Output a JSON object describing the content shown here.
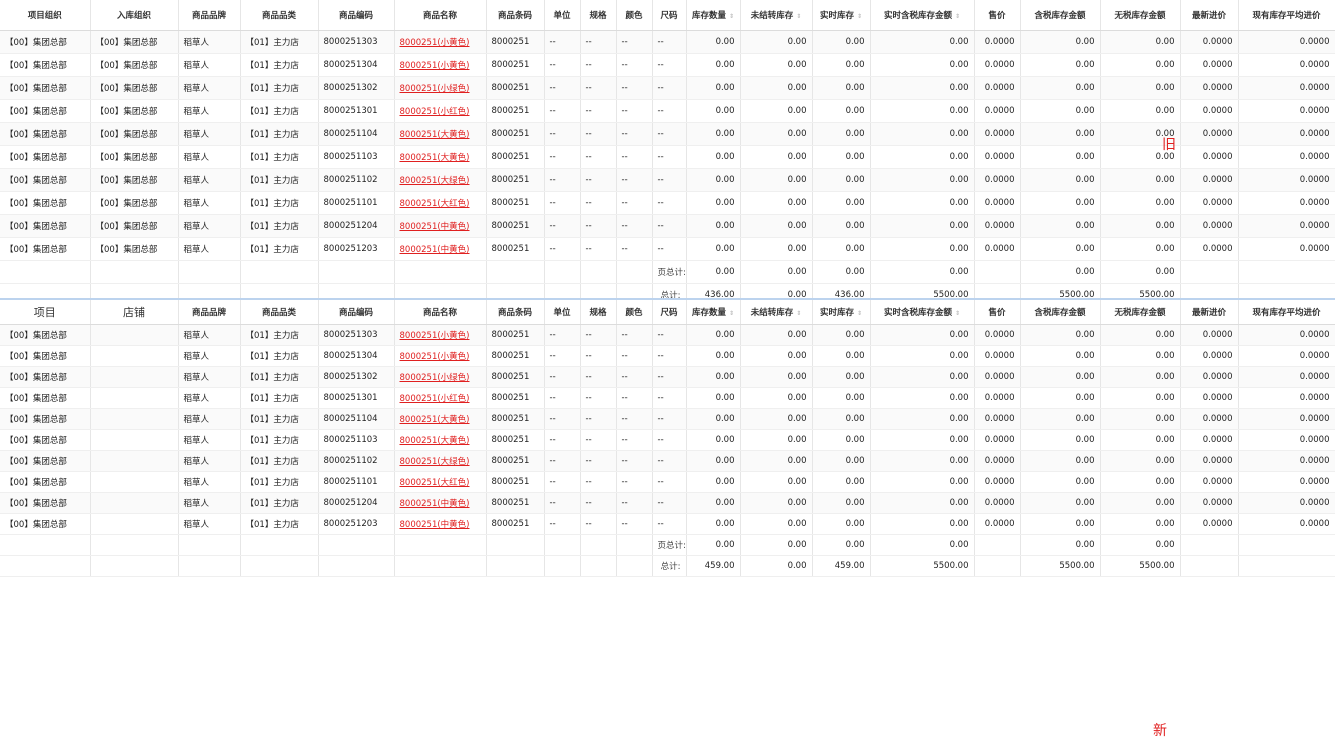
{
  "old_table": {
    "columns": [
      {
        "label": "项目组织",
        "sortable": false
      },
      {
        "label": "入库组织",
        "sortable": false
      },
      {
        "label": "商品品牌",
        "sortable": false
      },
      {
        "label": "商品品类",
        "sortable": false
      },
      {
        "label": "商品编码",
        "sortable": false
      },
      {
        "label": "商品名称",
        "sortable": false
      },
      {
        "label": "商品条码",
        "sortable": false
      },
      {
        "label": "单位",
        "sortable": false
      },
      {
        "label": "规格",
        "sortable": false
      },
      {
        "label": "颜色",
        "sortable": false
      },
      {
        "label": "尺码",
        "sortable": false
      },
      {
        "label": "库存数量",
        "sortable": true
      },
      {
        "label": "未结转库存",
        "sortable": true
      },
      {
        "label": "实时库存",
        "sortable": true
      },
      {
        "label": "实时含税库存金额",
        "sortable": true
      },
      {
        "label": "售价",
        "sortable": false
      },
      {
        "label": "含税库存金额",
        "sortable": false
      },
      {
        "label": "无税库存金额",
        "sortable": false
      },
      {
        "label": "最新进价",
        "sortable": false
      },
      {
        "label": "现有库存平均进价",
        "sortable": false
      }
    ],
    "rows": [
      [
        "【00】集团总部",
        "【00】集团总部",
        "稻草人",
        "【01】主力店",
        "8000251303",
        "8000251(小黄色)",
        "8000251",
        "--",
        "--",
        "--",
        "--",
        "0.00",
        "0.00",
        "0.00",
        "0.00",
        "0.0000",
        "0.00",
        "0.00",
        "0.0000",
        "0.0000"
      ],
      [
        "【00】集团总部",
        "【00】集团总部",
        "稻草人",
        "【01】主力店",
        "8000251304",
        "8000251(小黄色)",
        "8000251",
        "--",
        "--",
        "--",
        "--",
        "0.00",
        "0.00",
        "0.00",
        "0.00",
        "0.0000",
        "0.00",
        "0.00",
        "0.0000",
        "0.0000"
      ],
      [
        "【00】集团总部",
        "【00】集团总部",
        "稻草人",
        "【01】主力店",
        "8000251302",
        "8000251(小绿色)",
        "8000251",
        "--",
        "--",
        "--",
        "--",
        "0.00",
        "0.00",
        "0.00",
        "0.00",
        "0.0000",
        "0.00",
        "0.00",
        "0.0000",
        "0.0000"
      ],
      [
        "【00】集团总部",
        "【00】集团总部",
        "稻草人",
        "【01】主力店",
        "8000251301",
        "8000251(小红色)",
        "8000251",
        "--",
        "--",
        "--",
        "--",
        "0.00",
        "0.00",
        "0.00",
        "0.00",
        "0.0000",
        "0.00",
        "0.00",
        "0.0000",
        "0.0000"
      ],
      [
        "【00】集团总部",
        "【00】集团总部",
        "稻草人",
        "【01】主力店",
        "8000251104",
        "8000251(大黄色)",
        "8000251",
        "--",
        "--",
        "--",
        "--",
        "0.00",
        "0.00",
        "0.00",
        "0.00",
        "0.0000",
        "0.00",
        "0.00",
        "0.0000",
        "0.0000"
      ],
      [
        "【00】集团总部",
        "【00】集团总部",
        "稻草人",
        "【01】主力店",
        "8000251103",
        "8000251(大黄色)",
        "8000251",
        "--",
        "--",
        "--",
        "--",
        "0.00",
        "0.00",
        "0.00",
        "0.00",
        "0.0000",
        "0.00",
        "0.00",
        "0.0000",
        "0.0000"
      ],
      [
        "【00】集团总部",
        "【00】集团总部",
        "稻草人",
        "【01】主力店",
        "8000251102",
        "8000251(大绿色)",
        "8000251",
        "--",
        "--",
        "--",
        "--",
        "0.00",
        "0.00",
        "0.00",
        "0.00",
        "0.0000",
        "0.00",
        "0.00",
        "0.0000",
        "0.0000"
      ],
      [
        "【00】集团总部",
        "【00】集团总部",
        "稻草人",
        "【01】主力店",
        "8000251101",
        "8000251(大红色)",
        "8000251",
        "--",
        "--",
        "--",
        "--",
        "0.00",
        "0.00",
        "0.00",
        "0.00",
        "0.0000",
        "0.00",
        "0.00",
        "0.0000",
        "0.0000"
      ],
      [
        "【00】集团总部",
        "【00】集团总部",
        "稻草人",
        "【01】主力店",
        "8000251204",
        "8000251(中黄色)",
        "8000251",
        "--",
        "--",
        "--",
        "--",
        "0.00",
        "0.00",
        "0.00",
        "0.00",
        "0.0000",
        "0.00",
        "0.00",
        "0.0000",
        "0.0000"
      ],
      [
        "【00】集团总部",
        "【00】集团总部",
        "稻草人",
        "【01】主力店",
        "8000251203",
        "8000251(中黄色)",
        "8000251",
        "--",
        "--",
        "--",
        "--",
        "0.00",
        "0.00",
        "0.00",
        "0.00",
        "0.0000",
        "0.00",
        "0.00",
        "0.0000",
        "0.0000"
      ]
    ],
    "page_total": {
      "label": "页总计:",
      "stock_qty": "0.00",
      "unsettled": "0.00",
      "realtime": "0.00",
      "realtime_amount": "0.00",
      "price": "",
      "taxed_amount": "0.00",
      "untaxed_amount": "0.00"
    },
    "grand_total": {
      "label": "总计:",
      "stock_qty": "436.00",
      "unsettled": "0.00",
      "realtime": "436.00",
      "realtime_amount": "5500.00",
      "price": "",
      "taxed_amount": "5500.00",
      "untaxed_amount": "5500.00"
    }
  },
  "new_table": {
    "columns": [
      {
        "label": "项目",
        "sortable": false,
        "plain": true
      },
      {
        "label": "店铺",
        "sortable": false,
        "plain": true
      },
      {
        "label": "商品品牌",
        "sortable": false
      },
      {
        "label": "商品品类",
        "sortable": false
      },
      {
        "label": "商品编码",
        "sortable": false
      },
      {
        "label": "商品名称",
        "sortable": false
      },
      {
        "label": "商品条码",
        "sortable": false
      },
      {
        "label": "单位",
        "sortable": false
      },
      {
        "label": "规格",
        "sortable": false
      },
      {
        "label": "颜色",
        "sortable": false
      },
      {
        "label": "尺码",
        "sortable": false
      },
      {
        "label": "库存数量",
        "sortable": true
      },
      {
        "label": "未结转库存",
        "sortable": true
      },
      {
        "label": "实时库存",
        "sortable": true
      },
      {
        "label": "实时含税库存金额",
        "sortable": true
      },
      {
        "label": "售价",
        "sortable": false
      },
      {
        "label": "含税库存金额",
        "sortable": false
      },
      {
        "label": "无税库存金额",
        "sortable": false
      },
      {
        "label": "最新进价",
        "sortable": false
      },
      {
        "label": "现有库存平均进价",
        "sortable": false
      }
    ],
    "rows": [
      [
        "【00】集团总部",
        "",
        "稻草人",
        "【01】主力店",
        "8000251303",
        "8000251(小黄色)",
        "8000251",
        "--",
        "--",
        "--",
        "--",
        "0.00",
        "0.00",
        "0.00",
        "0.00",
        "0.0000",
        "0.00",
        "0.00",
        "0.0000",
        "0.0000"
      ],
      [
        "【00】集团总部",
        "",
        "稻草人",
        "【01】主力店",
        "8000251304",
        "8000251(小黄色)",
        "8000251",
        "--",
        "--",
        "--",
        "--",
        "0.00",
        "0.00",
        "0.00",
        "0.00",
        "0.0000",
        "0.00",
        "0.00",
        "0.0000",
        "0.0000"
      ],
      [
        "【00】集团总部",
        "",
        "稻草人",
        "【01】主力店",
        "8000251302",
        "8000251(小绿色)",
        "8000251",
        "--",
        "--",
        "--",
        "--",
        "0.00",
        "0.00",
        "0.00",
        "0.00",
        "0.0000",
        "0.00",
        "0.00",
        "0.0000",
        "0.0000"
      ],
      [
        "【00】集团总部",
        "",
        "稻草人",
        "【01】主力店",
        "8000251301",
        "8000251(小红色)",
        "8000251",
        "--",
        "--",
        "--",
        "--",
        "0.00",
        "0.00",
        "0.00",
        "0.00",
        "0.0000",
        "0.00",
        "0.00",
        "0.0000",
        "0.0000"
      ],
      [
        "【00】集团总部",
        "",
        "稻草人",
        "【01】主力店",
        "8000251104",
        "8000251(大黄色)",
        "8000251",
        "--",
        "--",
        "--",
        "--",
        "0.00",
        "0.00",
        "0.00",
        "0.00",
        "0.0000",
        "0.00",
        "0.00",
        "0.0000",
        "0.0000"
      ],
      [
        "【00】集团总部",
        "",
        "稻草人",
        "【01】主力店",
        "8000251103",
        "8000251(大黄色)",
        "8000251",
        "--",
        "--",
        "--",
        "--",
        "0.00",
        "0.00",
        "0.00",
        "0.00",
        "0.0000",
        "0.00",
        "0.00",
        "0.0000",
        "0.0000"
      ],
      [
        "【00】集团总部",
        "",
        "稻草人",
        "【01】主力店",
        "8000251102",
        "8000251(大绿色)",
        "8000251",
        "--",
        "--",
        "--",
        "--",
        "0.00",
        "0.00",
        "0.00",
        "0.00",
        "0.0000",
        "0.00",
        "0.00",
        "0.0000",
        "0.0000"
      ],
      [
        "【00】集团总部",
        "",
        "稻草人",
        "【01】主力店",
        "8000251101",
        "8000251(大红色)",
        "8000251",
        "--",
        "--",
        "--",
        "--",
        "0.00",
        "0.00",
        "0.00",
        "0.00",
        "0.0000",
        "0.00",
        "0.00",
        "0.0000",
        "0.0000"
      ],
      [
        "【00】集团总部",
        "",
        "稻草人",
        "【01】主力店",
        "8000251204",
        "8000251(中黄色)",
        "8000251",
        "--",
        "--",
        "--",
        "--",
        "0.00",
        "0.00",
        "0.00",
        "0.00",
        "0.0000",
        "0.00",
        "0.00",
        "0.0000",
        "0.0000"
      ],
      [
        "【00】集团总部",
        "",
        "稻草人",
        "【01】主力店",
        "8000251203",
        "8000251(中黄色)",
        "8000251",
        "--",
        "--",
        "--",
        "--",
        "0.00",
        "0.00",
        "0.00",
        "0.00",
        "0.0000",
        "0.00",
        "0.00",
        "0.0000",
        "0.0000"
      ]
    ],
    "page_total": {
      "label": "页总计:",
      "stock_qty": "0.00",
      "unsettled": "0.00",
      "realtime": "0.00",
      "realtime_amount": "0.00",
      "price": "",
      "taxed_amount": "0.00",
      "untaxed_amount": "0.00"
    },
    "grand_total": {
      "label": "总计:",
      "stock_qty": "459.00",
      "unsettled": "0.00",
      "realtime": "459.00",
      "realtime_amount": "5500.00",
      "price": "",
      "taxed_amount": "5500.00",
      "untaxed_amount": "5500.00"
    }
  },
  "tags": {
    "old": "旧",
    "new": "新"
  },
  "colors": {
    "link": "#e02020",
    "divider": "#bcd3ee"
  }
}
